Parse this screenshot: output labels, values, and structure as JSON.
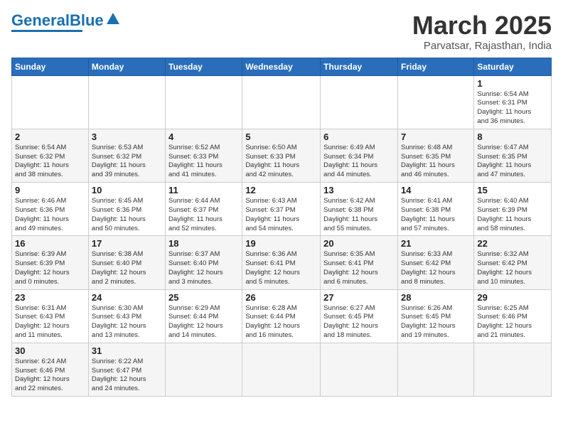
{
  "logo": {
    "text_general": "General",
    "text_blue": "Blue"
  },
  "title": "March 2025",
  "location": "Parvatsar, Rajasthan, India",
  "weekdays": [
    "Sunday",
    "Monday",
    "Tuesday",
    "Wednesday",
    "Thursday",
    "Friday",
    "Saturday"
  ],
  "weeks": [
    [
      {
        "day": "",
        "info": ""
      },
      {
        "day": "",
        "info": ""
      },
      {
        "day": "",
        "info": ""
      },
      {
        "day": "",
        "info": ""
      },
      {
        "day": "",
        "info": ""
      },
      {
        "day": "",
        "info": ""
      },
      {
        "day": "1",
        "info": "Sunrise: 6:54 AM\nSunset: 6:31 PM\nDaylight: 11 hours\nand 36 minutes."
      }
    ],
    [
      {
        "day": "2",
        "info": "Sunrise: 6:54 AM\nSunset: 6:32 PM\nDaylight: 11 hours\nand 38 minutes."
      },
      {
        "day": "3",
        "info": "Sunrise: 6:53 AM\nSunset: 6:32 PM\nDaylight: 11 hours\nand 39 minutes."
      },
      {
        "day": "4",
        "info": "Sunrise: 6:52 AM\nSunset: 6:33 PM\nDaylight: 11 hours\nand 41 minutes."
      },
      {
        "day": "5",
        "info": "Sunrise: 6:50 AM\nSunset: 6:33 PM\nDaylight: 11 hours\nand 42 minutes."
      },
      {
        "day": "6",
        "info": "Sunrise: 6:49 AM\nSunset: 6:34 PM\nDaylight: 11 hours\nand 44 minutes."
      },
      {
        "day": "7",
        "info": "Sunrise: 6:48 AM\nSunset: 6:35 PM\nDaylight: 11 hours\nand 46 minutes."
      },
      {
        "day": "8",
        "info": "Sunrise: 6:47 AM\nSunset: 6:35 PM\nDaylight: 11 hours\nand 47 minutes."
      }
    ],
    [
      {
        "day": "9",
        "info": "Sunrise: 6:46 AM\nSunset: 6:36 PM\nDaylight: 11 hours\nand 49 minutes."
      },
      {
        "day": "10",
        "info": "Sunrise: 6:45 AM\nSunset: 6:36 PM\nDaylight: 11 hours\nand 50 minutes."
      },
      {
        "day": "11",
        "info": "Sunrise: 6:44 AM\nSunset: 6:37 PM\nDaylight: 11 hours\nand 52 minutes."
      },
      {
        "day": "12",
        "info": "Sunrise: 6:43 AM\nSunset: 6:37 PM\nDaylight: 11 hours\nand 54 minutes."
      },
      {
        "day": "13",
        "info": "Sunrise: 6:42 AM\nSunset: 6:38 PM\nDaylight: 11 hours\nand 55 minutes."
      },
      {
        "day": "14",
        "info": "Sunrise: 6:41 AM\nSunset: 6:38 PM\nDaylight: 11 hours\nand 57 minutes."
      },
      {
        "day": "15",
        "info": "Sunrise: 6:40 AM\nSunset: 6:39 PM\nDaylight: 11 hours\nand 58 minutes."
      }
    ],
    [
      {
        "day": "16",
        "info": "Sunrise: 6:39 AM\nSunset: 6:39 PM\nDaylight: 12 hours\nand 0 minutes."
      },
      {
        "day": "17",
        "info": "Sunrise: 6:38 AM\nSunset: 6:40 PM\nDaylight: 12 hours\nand 2 minutes."
      },
      {
        "day": "18",
        "info": "Sunrise: 6:37 AM\nSunset: 6:40 PM\nDaylight: 12 hours\nand 3 minutes."
      },
      {
        "day": "19",
        "info": "Sunrise: 6:36 AM\nSunset: 6:41 PM\nDaylight: 12 hours\nand 5 minutes."
      },
      {
        "day": "20",
        "info": "Sunrise: 6:35 AM\nSunset: 6:41 PM\nDaylight: 12 hours\nand 6 minutes."
      },
      {
        "day": "21",
        "info": "Sunrise: 6:33 AM\nSunset: 6:42 PM\nDaylight: 12 hours\nand 8 minutes."
      },
      {
        "day": "22",
        "info": "Sunrise: 6:32 AM\nSunset: 6:42 PM\nDaylight: 12 hours\nand 10 minutes."
      }
    ],
    [
      {
        "day": "23",
        "info": "Sunrise: 6:31 AM\nSunset: 6:43 PM\nDaylight: 12 hours\nand 11 minutes."
      },
      {
        "day": "24",
        "info": "Sunrise: 6:30 AM\nSunset: 6:43 PM\nDaylight: 12 hours\nand 13 minutes."
      },
      {
        "day": "25",
        "info": "Sunrise: 6:29 AM\nSunset: 6:44 PM\nDaylight: 12 hours\nand 14 minutes."
      },
      {
        "day": "26",
        "info": "Sunrise: 6:28 AM\nSunset: 6:44 PM\nDaylight: 12 hours\nand 16 minutes."
      },
      {
        "day": "27",
        "info": "Sunrise: 6:27 AM\nSunset: 6:45 PM\nDaylight: 12 hours\nand 18 minutes."
      },
      {
        "day": "28",
        "info": "Sunrise: 6:26 AM\nSunset: 6:45 PM\nDaylight: 12 hours\nand 19 minutes."
      },
      {
        "day": "29",
        "info": "Sunrise: 6:25 AM\nSunset: 6:46 PM\nDaylight: 12 hours\nand 21 minutes."
      }
    ],
    [
      {
        "day": "30",
        "info": "Sunrise: 6:24 AM\nSunset: 6:46 PM\nDaylight: 12 hours\nand 22 minutes."
      },
      {
        "day": "31",
        "info": "Sunrise: 6:22 AM\nSunset: 6:47 PM\nDaylight: 12 hours\nand 24 minutes."
      },
      {
        "day": "",
        "info": ""
      },
      {
        "day": "",
        "info": ""
      },
      {
        "day": "",
        "info": ""
      },
      {
        "day": "",
        "info": ""
      },
      {
        "day": "",
        "info": ""
      }
    ]
  ]
}
